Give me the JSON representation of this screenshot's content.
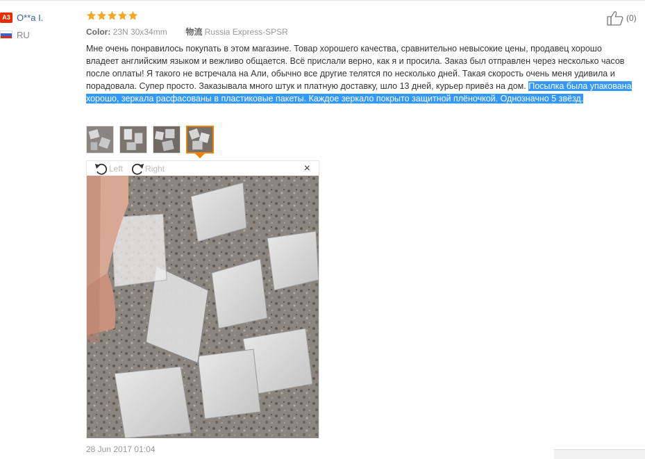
{
  "user": {
    "badge": "A3",
    "name": "O**a I.",
    "country": "RU"
  },
  "rating": {
    "stars": 5,
    "max": 5
  },
  "meta": {
    "color_label": "Color:",
    "color_value": "23N 30x34mm",
    "shipping_label": "物流",
    "shipping_value": "Russia Express-SPSR"
  },
  "review": {
    "text": "Мне очень понравилось покупать в этом магазине. Товар хорошего качества, сравнительно невысокие цены, продавец хорошо владеет английским языком и вежливо общается. Всё прислали верно, как я и просила. Заказ был отправлен через несколько часов после оплаты! Я такого не встречала на Али, обычно все другие телятся по несколько дней. Такая скорость очень меня удивила и порадовала. Супер просто. Заказывала много штук и платную доставку, шло 13 дней, курьер привёз на дом. ",
    "highlighted": "Посылка была упакована хорошо, зеркала расфасованы в пластиковые пакеты. Каждое зеркало покрыто защитной плёночкой. Однозначно 5 звёзд."
  },
  "viewer": {
    "rotate_left": "Left",
    "rotate_right": "Right",
    "close": "×"
  },
  "like": {
    "count": "(0)"
  },
  "date": "28 Jun 2017 01:04",
  "thumbnails": [
    {
      "name": "thumbnail-1",
      "active": false
    },
    {
      "name": "thumbnail-2",
      "active": false
    },
    {
      "name": "thumbnail-3",
      "active": false
    },
    {
      "name": "thumbnail-4",
      "active": true
    }
  ],
  "colors": {
    "link": "#3a5fa0",
    "star": "#f5a623",
    "highlight": "#3399ff",
    "accent": "#f08000",
    "badge": "#e62e04"
  }
}
